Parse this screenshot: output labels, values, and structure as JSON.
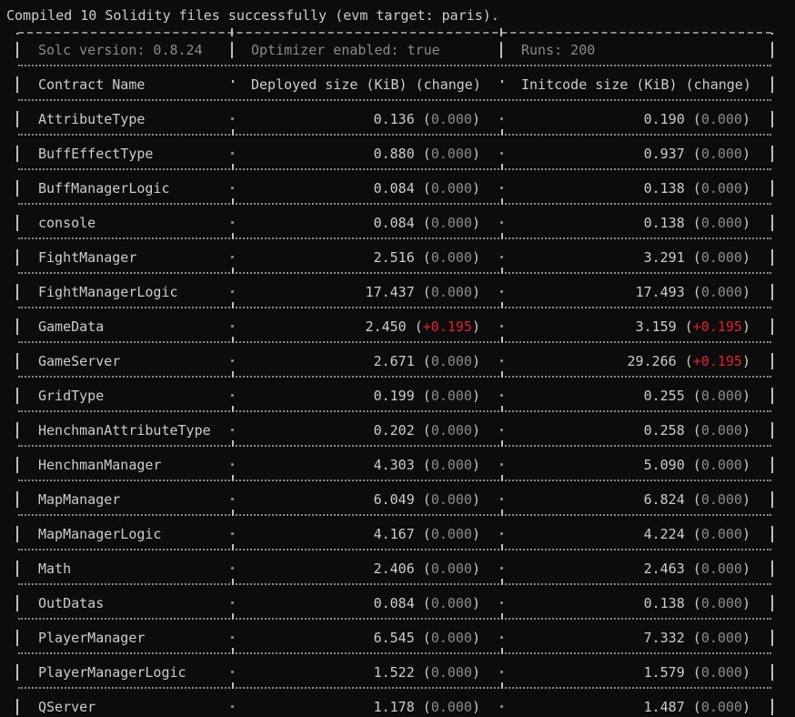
{
  "status_line": "Compiled 10 Solidity files successfully (evm target: paris).",
  "meta": {
    "solc": "Solc version: 0.8.24",
    "optimizer": "Optimizer enabled: true",
    "runs": "Runs: 200"
  },
  "headers": {
    "name": "Contract Name",
    "deployed": "Deployed size (KiB) (change)",
    "initcode": "Initcode size (KiB) (change)"
  },
  "rows": [
    {
      "name": "AttributeType",
      "dep": "0.136",
      "dep_chg": "0.000",
      "dep_pos": false,
      "init": "0.190",
      "init_chg": "0.000",
      "init_pos": false
    },
    {
      "name": "BuffEffectType",
      "dep": "0.880",
      "dep_chg": "0.000",
      "dep_pos": false,
      "init": "0.937",
      "init_chg": "0.000",
      "init_pos": false
    },
    {
      "name": "BuffManagerLogic",
      "dep": "0.084",
      "dep_chg": "0.000",
      "dep_pos": false,
      "init": "0.138",
      "init_chg": "0.000",
      "init_pos": false
    },
    {
      "name": "console",
      "dep": "0.084",
      "dep_chg": "0.000",
      "dep_pos": false,
      "init": "0.138",
      "init_chg": "0.000",
      "init_pos": false
    },
    {
      "name": "FightManager",
      "dep": "2.516",
      "dep_chg": "0.000",
      "dep_pos": false,
      "init": "3.291",
      "init_chg": "0.000",
      "init_pos": false
    },
    {
      "name": "FightManagerLogic",
      "dep": "17.437",
      "dep_chg": "0.000",
      "dep_pos": false,
      "init": "17.493",
      "init_chg": "0.000",
      "init_pos": false
    },
    {
      "name": "GameData",
      "dep": "2.450",
      "dep_chg": "+0.195",
      "dep_pos": true,
      "init": "3.159",
      "init_chg": "+0.195",
      "init_pos": true
    },
    {
      "name": "GameServer",
      "dep": "2.671",
      "dep_chg": "0.000",
      "dep_pos": false,
      "init": "29.266",
      "init_chg": "+0.195",
      "init_pos": true
    },
    {
      "name": "GridType",
      "dep": "0.199",
      "dep_chg": "0.000",
      "dep_pos": false,
      "init": "0.255",
      "init_chg": "0.000",
      "init_pos": false
    },
    {
      "name": "HenchmanAttributeType",
      "dep": "0.202",
      "dep_chg": "0.000",
      "dep_pos": false,
      "init": "0.258",
      "init_chg": "0.000",
      "init_pos": false
    },
    {
      "name": "HenchmanManager",
      "dep": "4.303",
      "dep_chg": "0.000",
      "dep_pos": false,
      "init": "5.090",
      "init_chg": "0.000",
      "init_pos": false
    },
    {
      "name": "MapManager",
      "dep": "6.049",
      "dep_chg": "0.000",
      "dep_pos": false,
      "init": "6.824",
      "init_chg": "0.000",
      "init_pos": false
    },
    {
      "name": "MapManagerLogic",
      "dep": "4.167",
      "dep_chg": "0.000",
      "dep_pos": false,
      "init": "4.224",
      "init_chg": "0.000",
      "init_pos": false
    },
    {
      "name": "Math",
      "dep": "2.406",
      "dep_chg": "0.000",
      "dep_pos": false,
      "init": "2.463",
      "init_chg": "0.000",
      "init_pos": false
    },
    {
      "name": "OutDatas",
      "dep": "0.084",
      "dep_chg": "0.000",
      "dep_pos": false,
      "init": "0.138",
      "init_chg": "0.000",
      "init_pos": false
    },
    {
      "name": "PlayerManager",
      "dep": "6.545",
      "dep_chg": "0.000",
      "dep_pos": false,
      "init": "7.332",
      "init_chg": "0.000",
      "init_pos": false
    },
    {
      "name": "PlayerManagerLogic",
      "dep": "1.522",
      "dep_chg": "0.000",
      "dep_pos": false,
      "init": "1.579",
      "init_chg": "0.000",
      "init_pos": false
    },
    {
      "name": "QServer",
      "dep": "1.178",
      "dep_chg": "0.000",
      "dep_pos": false,
      "init": "1.487",
      "init_chg": "0.000",
      "init_pos": false
    }
  ],
  "colors": {
    "background": "#0c0c0c",
    "text": "#cccccc",
    "muted": "#8a8a8a",
    "increase": "#e0212c"
  }
}
